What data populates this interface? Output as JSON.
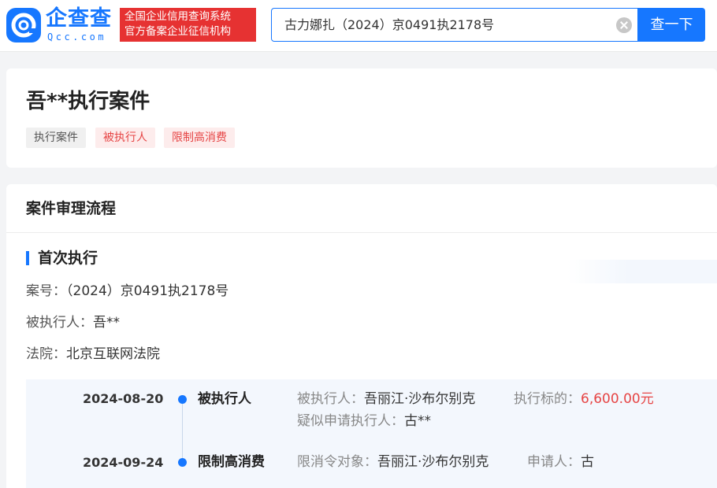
{
  "header": {
    "logo_text": "企查查",
    "logo_sub": "Qcc.com",
    "slogan_line1": "全国企业信用查询系统",
    "slogan_line2": "官方备案企业征信机构",
    "search_value": "古力娜扎（2024）京0491执2178号",
    "search_button": "查一下"
  },
  "case": {
    "title": "吾**执行案件",
    "tags": [
      "执行案件",
      "被执行人",
      "限制高消费"
    ]
  },
  "process": {
    "section_title": "案件审理流程",
    "stage_title": "首次执行",
    "case_no_label": "案号：",
    "case_no": "（2024）京0491执2178号",
    "executed_label": "被执行人：",
    "executed": "吾**",
    "court_label": "法院：",
    "court": "北京互联网法院",
    "timeline": [
      {
        "date": "2024-08-20",
        "type": "被执行人",
        "field1_label": "被执行人：",
        "field1_value": "吾丽江·沙布尔别克",
        "field2_label": "执行标的：",
        "field2_value": "6,600.00元",
        "field3_label": "疑似申请执行人：",
        "field3_value": "古**"
      },
      {
        "date": "2024-09-24",
        "type": "限制高消费",
        "field1_label": "限消令对象：",
        "field1_value": "吾丽江·沙布尔别克",
        "field2_label": "申请人：",
        "field2_value": "古"
      }
    ]
  },
  "colors": {
    "brand_blue": "#1677ff",
    "alert_red": "#e64545"
  }
}
